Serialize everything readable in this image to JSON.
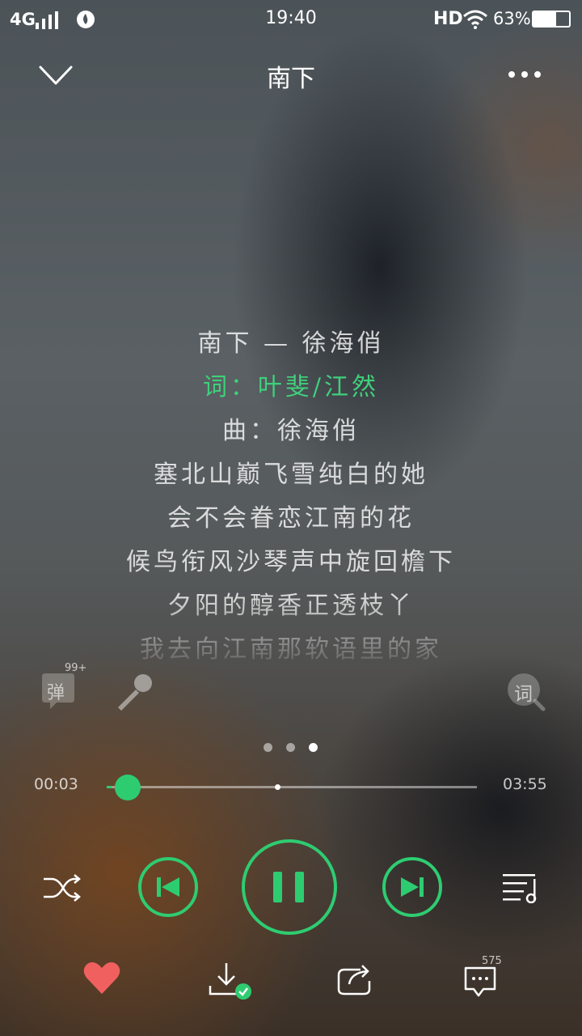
{
  "status_bar": {
    "network": "4G",
    "time": "19:40",
    "hd": "HD",
    "battery": "63%",
    "battery_level": 0.63
  },
  "header": {
    "title": "南下"
  },
  "lyrics": {
    "lines": [
      "南下 — 徐海俏",
      "词：叶斐/江然",
      "曲：徐海俏",
      "塞北山巅飞雪纯白的她",
      "会不会眷恋江南的花",
      "候鸟衔风沙琴声中旋回檐下",
      "夕阳的醇香正透枝丫",
      "我去向江南那软语里的家"
    ],
    "active_index": 1
  },
  "tools": {
    "danmaku_label": "弹",
    "danmaku_count": "99+",
    "lyrics_search_label": "词"
  },
  "pager": {
    "pages": 3,
    "current": 3
  },
  "progress": {
    "elapsed": "00:03",
    "total": "03:55",
    "played_fraction": 0.013,
    "buffered_fraction": 0.46
  },
  "bottom": {
    "comment_count": "575"
  },
  "colors": {
    "accent": "#2ecc71",
    "heart": "#f0605f"
  }
}
